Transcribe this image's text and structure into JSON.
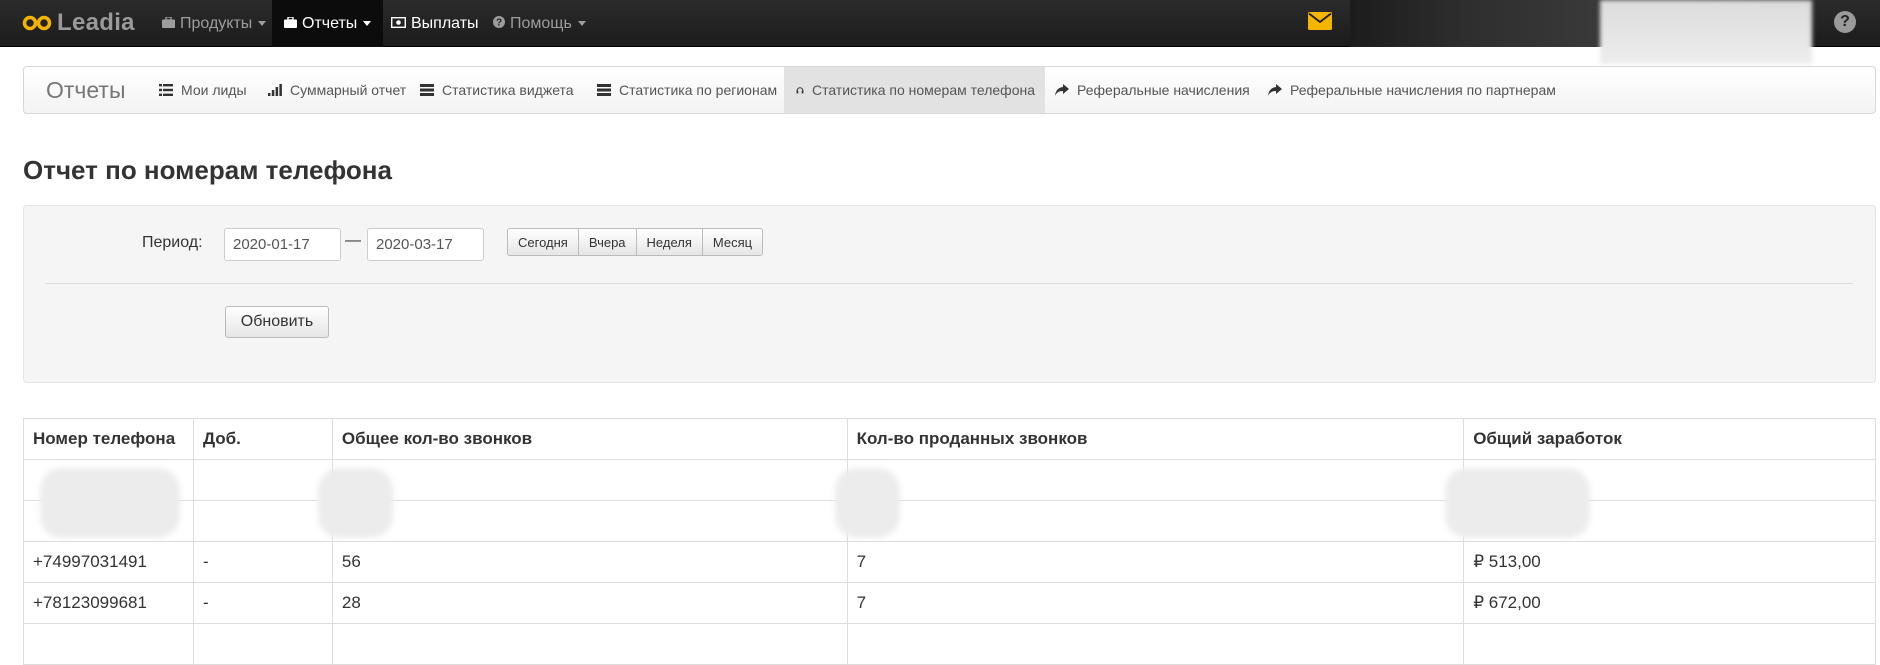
{
  "navbar": {
    "brand": "Leadia",
    "items": [
      {
        "label": "Продукты",
        "icon": "briefcase-icon",
        "dropdown": true
      },
      {
        "label": "Отчеты",
        "icon": "briefcase-icon",
        "dropdown": true,
        "active": true
      },
      {
        "label": "Выплаты",
        "icon": "money-icon",
        "dropdown": false
      },
      {
        "label": "Помощь",
        "icon": "question-icon",
        "dropdown": true
      }
    ],
    "help": "?"
  },
  "subnav": {
    "title": "Отчеты",
    "items": [
      {
        "label": "Мои лиды",
        "icon": "list-icon"
      },
      {
        "label": "Суммарный отчет",
        "icon": "signal-icon"
      },
      {
        "label": "Статистика виджета",
        "icon": "stack-icon"
      },
      {
        "label": "Статистика по регионам",
        "icon": "stack-icon"
      },
      {
        "label": "Статистика по номерам телефона",
        "icon": "headphones-icon",
        "active": true
      },
      {
        "label": "Реферальные начисления",
        "icon": "share-icon"
      },
      {
        "label": "Реферальные начисления по партнерам",
        "icon": "share-icon"
      }
    ]
  },
  "page": {
    "title": "Отчет по номерам телефона"
  },
  "filter": {
    "period_label": "Период:",
    "date_from": "2020-01-17",
    "date_to": "2020-03-17",
    "separator": "—",
    "quick": [
      "Сегодня",
      "Вчера",
      "Неделя",
      "Месяц"
    ],
    "refresh": "Обновить"
  },
  "table": {
    "headers": [
      "Номер телефона",
      "Доб.",
      "Общее кол-во звонков",
      "Кол-во проданных звонков",
      "Общий заработок"
    ],
    "rows": [
      [
        "",
        "",
        "",
        "",
        ""
      ],
      [
        "",
        "",
        "",
        "",
        ""
      ],
      [
        "+74997031491",
        "-",
        "56",
        "7",
        "₽ 513,00"
      ],
      [
        "+78123099681",
        "-",
        "28",
        "7",
        "₽ 672,00"
      ],
      [
        "",
        "",
        "",
        "",
        ""
      ]
    ]
  },
  "colors": {
    "navbar": "#1c1c1c",
    "brand_logo": "#f5b400",
    "mail_icon": "#f5b400",
    "panel": "#f5f5f5"
  }
}
